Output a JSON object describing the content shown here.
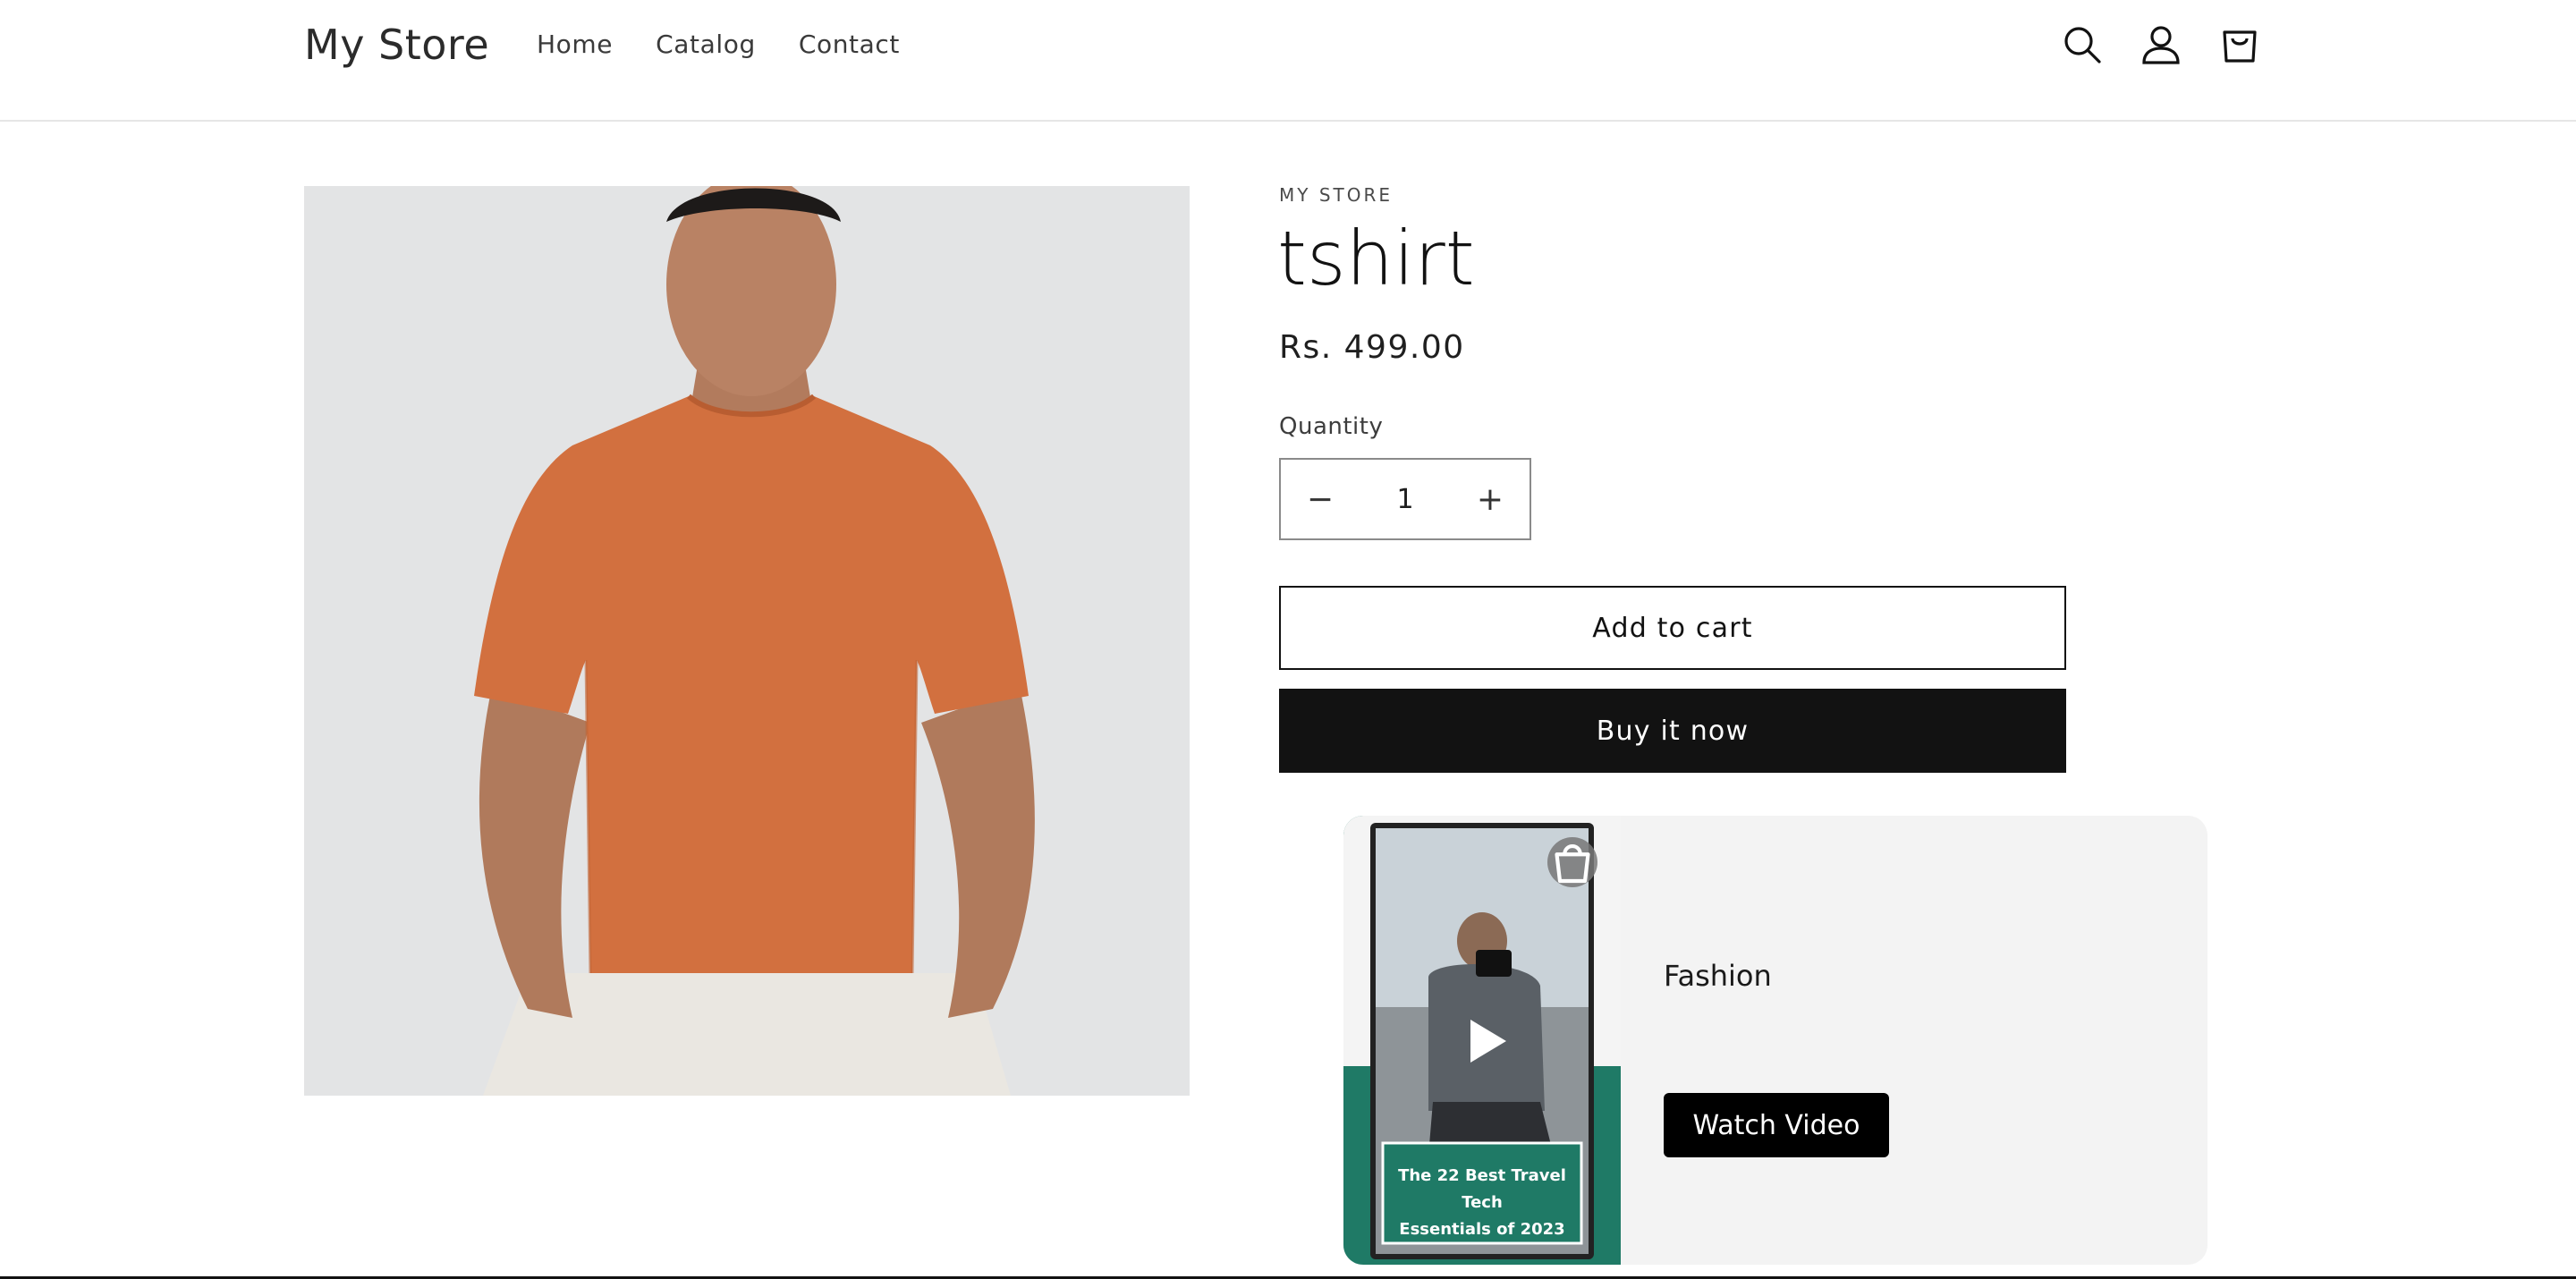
{
  "header": {
    "logo": "My Store",
    "nav": [
      "Home",
      "Catalog",
      "Contact"
    ],
    "icons": [
      "search-icon",
      "account-icon",
      "cart-icon"
    ]
  },
  "product": {
    "vendor": "MY STORE",
    "title": "tshirt",
    "price": "Rs. 499.00",
    "quantity_label": "Quantity",
    "quantity_value": "1",
    "add_to_cart": "Add to cart",
    "buy_now": "Buy it now",
    "image_colors": {
      "shirt": "#d2703f",
      "background": "#e9e9ea"
    }
  },
  "video_card": {
    "title": "Fashion",
    "button": "Watch Video",
    "thumbnail_caption": "The 22 Best Travel Tech Essentials of 2023",
    "thumbnail_caption_lines": [
      "The 22 Best Travel Tech",
      "Essentials of 2023"
    ],
    "icons": [
      "play-icon",
      "shopping-bag-icon"
    ],
    "accent_color": "#1f7a66"
  }
}
